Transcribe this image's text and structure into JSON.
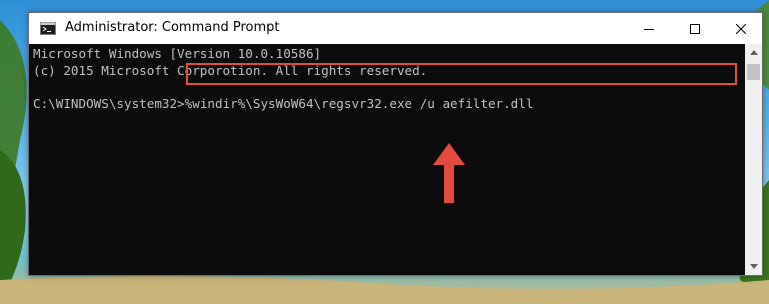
{
  "window": {
    "title": "Administrator: Command Prompt",
    "controls": {
      "minimize": "—",
      "maximize": "☐",
      "close": "✕"
    }
  },
  "console": {
    "lines": [
      "Microsoft Windows [Version 10.0.10586]",
      "(c) 2015 Microsoft Corporotion. All rights reserved."
    ],
    "prompt": "C:\\WINDOWS\\system32>",
    "command": "%windir%\\SysWoW64\\regsvr32.exe /u aefilter.dll"
  },
  "annotation": {
    "highlight_color": "#e34b3e",
    "arrow_color": "#e34b3e",
    "arrow_direction": "up"
  },
  "icons": {
    "app": "cmd-icon",
    "scroll_up": "scroll-up-icon",
    "scroll_down": "scroll-down-icon"
  }
}
